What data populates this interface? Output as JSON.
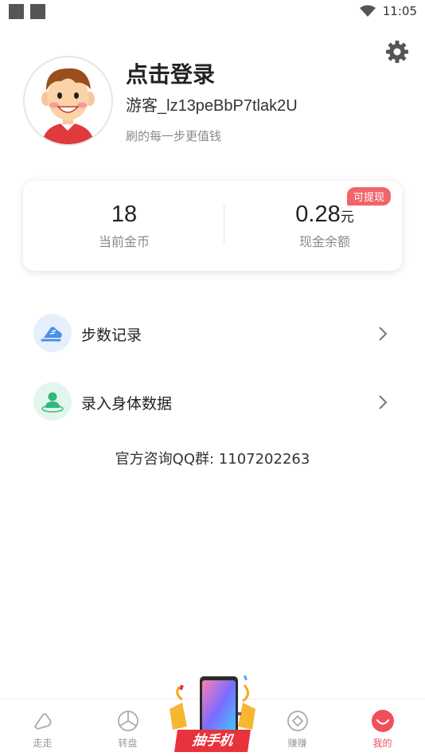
{
  "status_bar": {
    "time": "11:05"
  },
  "profile": {
    "title": "点击登录",
    "guest_name": "游客_lz13peBbP7tlak2U",
    "slogan": "刷的每一步更值钱"
  },
  "balance": {
    "coins_value": "18",
    "coins_label": "当前金币",
    "cash_value": "0.28",
    "cash_unit": "元",
    "cash_label": "现金余额",
    "withdraw_badge": "可提现"
  },
  "menu": [
    {
      "label": "步数记录",
      "icon": "shoe-icon",
      "color": "#4a8fe8"
    },
    {
      "label": "录入身体数据",
      "icon": "person-icon",
      "color": "#2fb87a"
    }
  ],
  "qq_group": "官方咨询QQ群: 1107202263",
  "tabbar": {
    "tabs": [
      {
        "label": "走走",
        "icon": "shoe-outline-icon"
      },
      {
        "label": "转盘",
        "icon": "wheel-icon"
      },
      {
        "label": "赚赚",
        "icon": "coin-icon"
      },
      {
        "label": "我的",
        "icon": "smile-icon",
        "active": true
      }
    ],
    "lottery_label": "抽手机"
  },
  "colors": {
    "accent": "#f0505a",
    "badge": "#f0646a"
  }
}
